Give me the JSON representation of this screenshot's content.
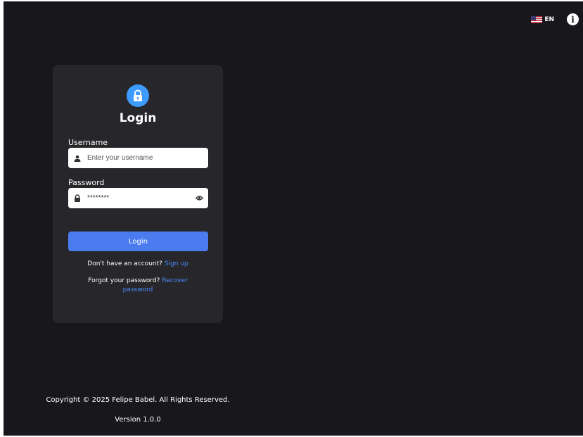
{
  "topbar": {
    "language": "EN",
    "flag_icon": "us-flag-icon",
    "info_icon": "info-icon"
  },
  "login": {
    "lock_icon": "lock-icon",
    "title": "Login",
    "username_label": "Username",
    "username_placeholder": "Enter your username",
    "password_label": "Password",
    "password_value": "********",
    "button_label": "Login",
    "signup_prompt": "Don't have an account?",
    "signup_link": "Sign up",
    "recover_prompt": "Forgot your password?",
    "recover_link_1": "Recover",
    "recover_link_2": "password"
  },
  "footer": {
    "copyright": "Copyright © 2025 Felipe Babel. All Rights Reserved.",
    "version": "Version 1.0.0"
  },
  "colors": {
    "background": "#18181c",
    "card": "#27272b",
    "primary": "#4a7cf0",
    "link": "#4a8cff",
    "lock_badge": "#3d9bff"
  }
}
